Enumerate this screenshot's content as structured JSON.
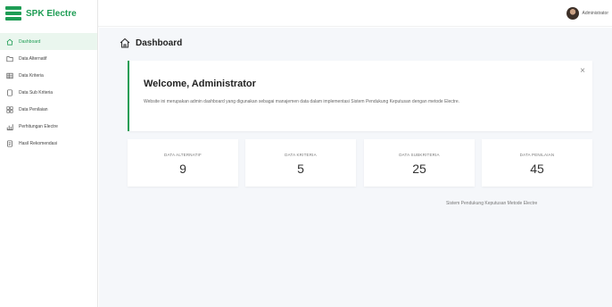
{
  "brand": {
    "name": "SPK Electre",
    "color": "#1f9d55"
  },
  "topbar": {
    "user_name": "Administrator"
  },
  "sidebar": {
    "items": [
      {
        "label": "Dashboard",
        "icon": "home-icon",
        "active": true
      },
      {
        "label": "Data Alternatif",
        "icon": "folder-icon",
        "active": false
      },
      {
        "label": "Data Kriteria",
        "icon": "table-icon",
        "active": false
      },
      {
        "label": "Data Sub Kriteria",
        "icon": "document-icon",
        "active": false
      },
      {
        "label": "Data Penilaian",
        "icon": "grid-icon",
        "active": false
      },
      {
        "label": "Perhitungan Electre",
        "icon": "chart-icon",
        "active": false
      },
      {
        "label": "Hasil Rekomendasi",
        "icon": "report-icon",
        "active": false
      }
    ]
  },
  "main": {
    "page_title": "Dashboard",
    "welcome": {
      "title": "Welcome, Administrator",
      "text": "Website ini merupakan admin dashboard yang digunakan sebagai manajemen data dalam implementasi Sistem Pendukung Keputusan dengan metode Electre.",
      "close": "×"
    },
    "stats": [
      {
        "label": "DATA ALTERNATIF",
        "value": "9"
      },
      {
        "label": "DATA KRITERIA",
        "value": "5"
      },
      {
        "label": "DATA SUBKRITERIA",
        "value": "25"
      },
      {
        "label": "DATA PENILAIAN",
        "value": "45"
      }
    ],
    "footer": "Sistem Pendukung Keputusan Metode Electre"
  }
}
